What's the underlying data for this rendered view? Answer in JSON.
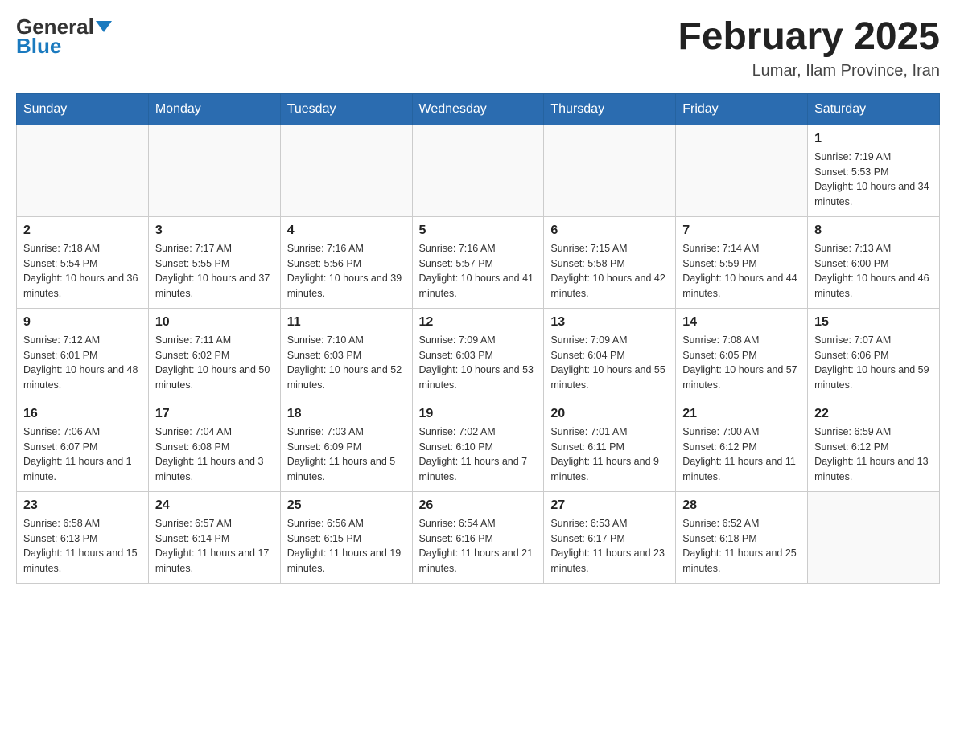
{
  "header": {
    "logo_general": "General",
    "logo_blue": "Blue",
    "month_title": "February 2025",
    "location": "Lumar, Ilam Province, Iran"
  },
  "days_of_week": [
    "Sunday",
    "Monday",
    "Tuesday",
    "Wednesday",
    "Thursday",
    "Friday",
    "Saturday"
  ],
  "weeks": [
    [
      null,
      null,
      null,
      null,
      null,
      null,
      {
        "day": 1,
        "sunrise": "7:19 AM",
        "sunset": "5:53 PM",
        "daylight": "10 hours and 34 minutes."
      }
    ],
    [
      {
        "day": 2,
        "sunrise": "7:18 AM",
        "sunset": "5:54 PM",
        "daylight": "10 hours and 36 minutes."
      },
      {
        "day": 3,
        "sunrise": "7:17 AM",
        "sunset": "5:55 PM",
        "daylight": "10 hours and 37 minutes."
      },
      {
        "day": 4,
        "sunrise": "7:16 AM",
        "sunset": "5:56 PM",
        "daylight": "10 hours and 39 minutes."
      },
      {
        "day": 5,
        "sunrise": "7:16 AM",
        "sunset": "5:57 PM",
        "daylight": "10 hours and 41 minutes."
      },
      {
        "day": 6,
        "sunrise": "7:15 AM",
        "sunset": "5:58 PM",
        "daylight": "10 hours and 42 minutes."
      },
      {
        "day": 7,
        "sunrise": "7:14 AM",
        "sunset": "5:59 PM",
        "daylight": "10 hours and 44 minutes."
      },
      {
        "day": 8,
        "sunrise": "7:13 AM",
        "sunset": "6:00 PM",
        "daylight": "10 hours and 46 minutes."
      }
    ],
    [
      {
        "day": 9,
        "sunrise": "7:12 AM",
        "sunset": "6:01 PM",
        "daylight": "10 hours and 48 minutes."
      },
      {
        "day": 10,
        "sunrise": "7:11 AM",
        "sunset": "6:02 PM",
        "daylight": "10 hours and 50 minutes."
      },
      {
        "day": 11,
        "sunrise": "7:10 AM",
        "sunset": "6:03 PM",
        "daylight": "10 hours and 52 minutes."
      },
      {
        "day": 12,
        "sunrise": "7:09 AM",
        "sunset": "6:03 PM",
        "daylight": "10 hours and 53 minutes."
      },
      {
        "day": 13,
        "sunrise": "7:09 AM",
        "sunset": "6:04 PM",
        "daylight": "10 hours and 55 minutes."
      },
      {
        "day": 14,
        "sunrise": "7:08 AM",
        "sunset": "6:05 PM",
        "daylight": "10 hours and 57 minutes."
      },
      {
        "day": 15,
        "sunrise": "7:07 AM",
        "sunset": "6:06 PM",
        "daylight": "10 hours and 59 minutes."
      }
    ],
    [
      {
        "day": 16,
        "sunrise": "7:06 AM",
        "sunset": "6:07 PM",
        "daylight": "11 hours and 1 minute."
      },
      {
        "day": 17,
        "sunrise": "7:04 AM",
        "sunset": "6:08 PM",
        "daylight": "11 hours and 3 minutes."
      },
      {
        "day": 18,
        "sunrise": "7:03 AM",
        "sunset": "6:09 PM",
        "daylight": "11 hours and 5 minutes."
      },
      {
        "day": 19,
        "sunrise": "7:02 AM",
        "sunset": "6:10 PM",
        "daylight": "11 hours and 7 minutes."
      },
      {
        "day": 20,
        "sunrise": "7:01 AM",
        "sunset": "6:11 PM",
        "daylight": "11 hours and 9 minutes."
      },
      {
        "day": 21,
        "sunrise": "7:00 AM",
        "sunset": "6:12 PM",
        "daylight": "11 hours and 11 minutes."
      },
      {
        "day": 22,
        "sunrise": "6:59 AM",
        "sunset": "6:12 PM",
        "daylight": "11 hours and 13 minutes."
      }
    ],
    [
      {
        "day": 23,
        "sunrise": "6:58 AM",
        "sunset": "6:13 PM",
        "daylight": "11 hours and 15 minutes."
      },
      {
        "day": 24,
        "sunrise": "6:57 AM",
        "sunset": "6:14 PM",
        "daylight": "11 hours and 17 minutes."
      },
      {
        "day": 25,
        "sunrise": "6:56 AM",
        "sunset": "6:15 PM",
        "daylight": "11 hours and 19 minutes."
      },
      {
        "day": 26,
        "sunrise": "6:54 AM",
        "sunset": "6:16 PM",
        "daylight": "11 hours and 21 minutes."
      },
      {
        "day": 27,
        "sunrise": "6:53 AM",
        "sunset": "6:17 PM",
        "daylight": "11 hours and 23 minutes."
      },
      {
        "day": 28,
        "sunrise": "6:52 AM",
        "sunset": "6:18 PM",
        "daylight": "11 hours and 25 minutes."
      },
      null
    ]
  ]
}
